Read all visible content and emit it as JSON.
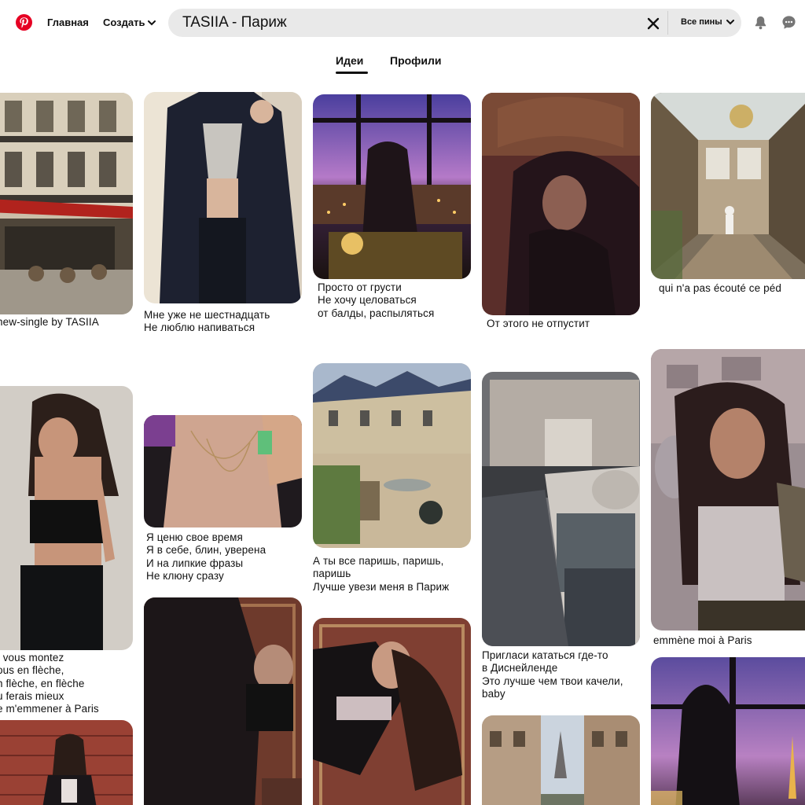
{
  "header": {
    "logo_icon": "pinterest-logo-icon",
    "brand_color": "#e60023",
    "nav_home": "Главная",
    "nav_create": "Создать",
    "search_value": "TASIIA - Париж",
    "clear_icon": "close-icon",
    "filter_label": "Все пины",
    "notifications_icon": "bell-icon",
    "messages_icon": "chat-bubble-icon"
  },
  "tabs": {
    "ideas": "Идеи",
    "profiles": "Профили",
    "active": "ideas"
  },
  "pins": [
    {
      "id": "paris-cafe-street",
      "caption": [
        "new-single by TASIIA"
      ]
    },
    {
      "id": "blazer-outfit",
      "caption": [
        "Мне уже не шестнадцать",
        "Не люблю напиваться"
      ]
    },
    {
      "id": "window-night-city",
      "caption": [
        "Просто от грусти",
        "Не хочу целоваться",
        "от балды, распыляться"
      ]
    },
    {
      "id": "dark-hair-portrait",
      "caption": [
        "От этого не отпустит"
      ]
    },
    {
      "id": "greenhouse-stairs",
      "caption": [
        "qui n'a pas écouté ce péd"
      ]
    },
    {
      "id": "black-top-jeans",
      "caption": [
        "t vous montez",
        "ous en flèche,",
        "n flèche, en flèche",
        "u ferais mieux",
        "e m'emmener à Paris"
      ]
    },
    {
      "id": "necklace-closeup",
      "caption": [
        "Я ценю свое время",
        "Я в себе, блин, уверена",
        "И на липкие фразы",
        "Не клюну сразу"
      ]
    },
    {
      "id": "courtyard-terrace",
      "caption": [
        "А ты все паришь, паришь,",
        "паришь",
        "Лучше увези меня в Париж"
      ]
    },
    {
      "id": "aerial-pantheon",
      "caption": [
        "Пригласи кататься где-то",
        "в Диснейленде",
        "Это лучше чем твои качели,",
        "baby"
      ]
    },
    {
      "id": "overlay-portrait",
      "caption": [
        "emmène moi à Paris"
      ]
    },
    {
      "id": "brick-wall-girl",
      "caption": []
    },
    {
      "id": "lying-on-carpet",
      "caption": []
    },
    {
      "id": "lying-on-rug",
      "caption": []
    },
    {
      "id": "eiffel-street",
      "caption": []
    },
    {
      "id": "silhouette-eiffel-night",
      "caption": []
    }
  ]
}
